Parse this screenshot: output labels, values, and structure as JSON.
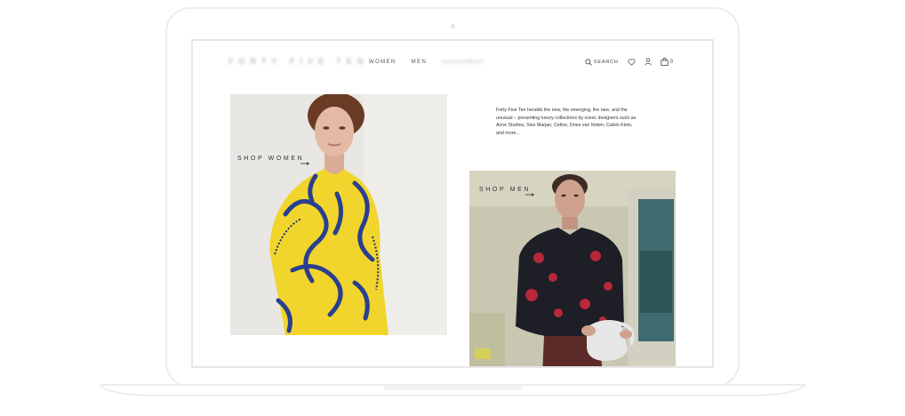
{
  "header": {
    "logo": "FORTY FIVE TEN",
    "nav": [
      "WOMEN",
      "MEN",
      "ᴀᴄᴄᴇssᴏʀɪᴇs"
    ],
    "search_label": "SEARCH",
    "bag_count": "0"
  },
  "hero": {
    "women_link": "SHOP WOMEN",
    "men_link": "SHOP MEN",
    "intro": "Forty Five Ten heralds the new, the emerging, the rare, and the unusual – presenting luxury collections by iconic designers such as Acne Studios, Sies Marjan, Celine, Dries van Noten, Calvin Klein, and more..."
  },
  "icons": [
    "search-icon",
    "heart-icon",
    "user-icon",
    "bag-icon",
    "arrow-right-icon"
  ]
}
